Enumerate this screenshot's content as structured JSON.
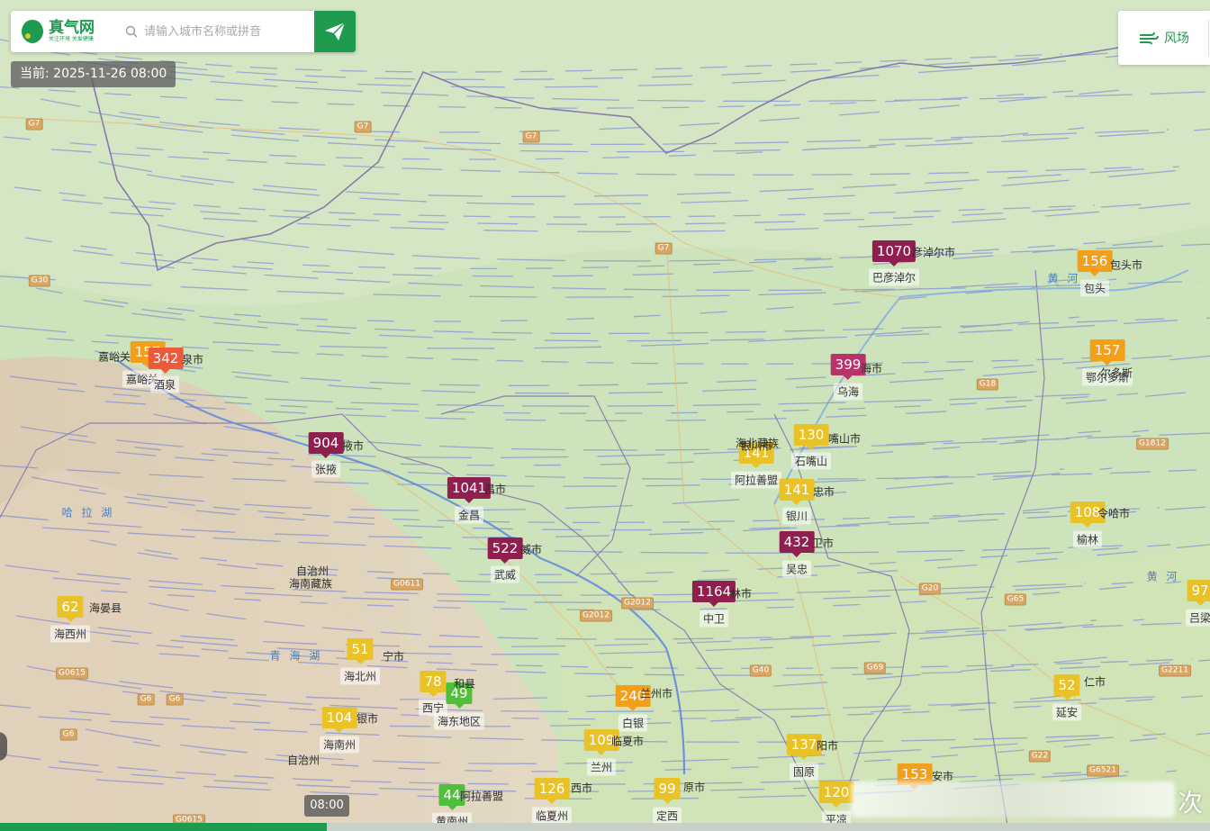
{
  "header": {
    "logo_name": "真气网",
    "logo_slogan": "关注环境 关爱健康",
    "search_placeholder": "请输入城市名称或拼音",
    "current_time": "当前: 2025-11-26 08:00",
    "wind_toggle_label": "风场"
  },
  "timeline": {
    "current": "08:00",
    "progress_fraction": 0.27
  },
  "aqi_colors": {
    "good": "#4fbf3c",
    "moderate": "#e8c227",
    "sensitive": "#f2a01c",
    "unhealthy": "#ec5a3a",
    "very_unhealthy": "#b8336a",
    "hazardous": "#8e1f4e"
  },
  "stations": [
    {
      "aqi": "157",
      "city": "嘉峪关",
      "level": "sensitive"
    },
    {
      "aqi": "342",
      "city": "酒泉",
      "level": "unhealthy"
    },
    {
      "aqi": "904",
      "city": "张掖",
      "level": "hazardous"
    },
    {
      "aqi": "1041",
      "city": "金昌",
      "level": "hazardous"
    },
    {
      "aqi": "522",
      "city": "武威",
      "level": "hazardous"
    },
    {
      "aqi": "1070",
      "city": "巴彦淖尔",
      "level": "hazardous"
    },
    {
      "aqi": "156",
      "city": "包头",
      "level": "sensitive"
    },
    {
      "aqi": "157",
      "city": "鄂尔多斯",
      "level": "sensitive"
    },
    {
      "aqi": "399",
      "city": "乌海",
      "level": "very_unhealthy"
    },
    {
      "aqi": "130",
      "city": "石嘴山",
      "level": "moderate"
    },
    {
      "aqi": "141",
      "city": "阿拉善盟",
      "level": "moderate"
    },
    {
      "aqi": "141",
      "city": "银川",
      "level": "moderate"
    },
    {
      "aqi": "432",
      "city": "吴忠",
      "level": "hazardous"
    },
    {
      "aqi": "1164",
      "city": "中卫",
      "level": "hazardous"
    },
    {
      "aqi": "108",
      "city": "榆林",
      "level": "moderate"
    },
    {
      "aqi": "97",
      "city": "吕梁",
      "level": "moderate"
    },
    {
      "aqi": "62",
      "city": "海西州",
      "level": "moderate"
    },
    {
      "aqi": "51",
      "city": "海北州",
      "level": "moderate"
    },
    {
      "aqi": "78",
      "city": "西宁",
      "level": "moderate"
    },
    {
      "aqi": "49",
      "city": "海东地区",
      "level": "good"
    },
    {
      "aqi": "104",
      "city": "海南州",
      "level": "moderate"
    },
    {
      "aqi": "240",
      "city": "白银",
      "level": "sensitive"
    },
    {
      "aqi": "109",
      "city": "兰州",
      "level": "moderate"
    },
    {
      "aqi": "126",
      "city": "临夏州",
      "level": "moderate"
    },
    {
      "aqi": "99",
      "city": "定西",
      "level": "moderate"
    },
    {
      "aqi": "137",
      "city": "固原",
      "level": "moderate"
    },
    {
      "aqi": "120",
      "city": "平凉",
      "level": "moderate"
    },
    {
      "aqi": "153",
      "city": "",
      "level": "sensitive"
    },
    {
      "aqi": "52",
      "city": "延安",
      "level": "moderate"
    },
    {
      "aqi": "44",
      "city": "黄南州",
      "level": "good"
    }
  ],
  "place_labels": [
    "嘉峪关",
    "泉市",
    "掖市",
    "昌市",
    "威市",
    "彦淖尔市",
    "包头市",
    "海市",
    "尔多斯",
    "嘴山市",
    "银川市",
    "忠市",
    "卫市",
    "林市",
    "令哈市",
    "海晏县",
    "宁市",
    "和县",
    "银市",
    "兰州市",
    "临夏市",
    "西市",
    "原市",
    "阳市",
    "安市",
    "仁市",
    "阿拉善盟",
    "海北藏族",
    "自治州",
    "海南藏族",
    "自治州"
  ],
  "water_labels": [
    "哈 拉 湖",
    "青 海 湖",
    "黄 河",
    "黄 河"
  ],
  "highways": [
    "G7",
    "G7",
    "G7",
    "G7",
    "G30",
    "G6",
    "G6",
    "G0615",
    "G6",
    "G0611",
    "G2012",
    "G2012",
    "G40",
    "G20",
    "G65",
    "G69",
    "G1812",
    "G18",
    "G2211",
    "G22",
    "G6521",
    "G0615"
  ],
  "forecast_glyph": "次"
}
